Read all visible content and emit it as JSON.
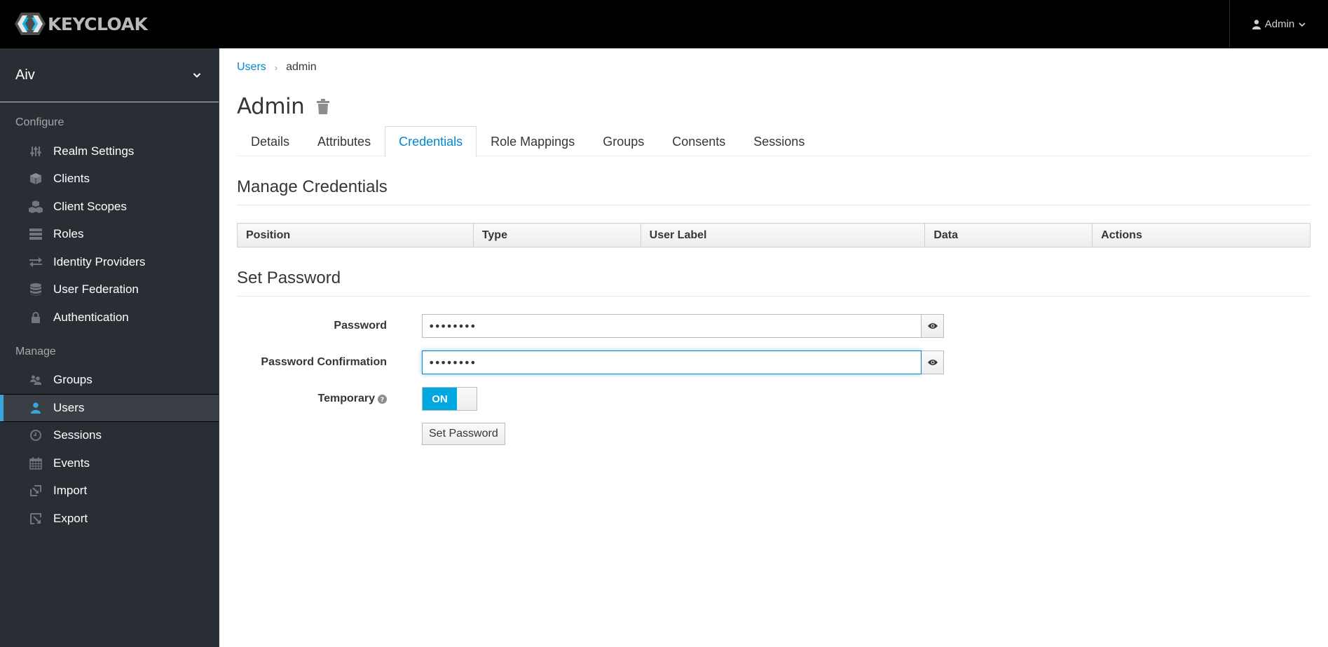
{
  "header": {
    "logo_text": "KEYCLOAK",
    "user_menu_label": "Admin",
    "user_icon": "user-icon",
    "chevron_icon": "chevron-down-icon"
  },
  "sidebar": {
    "realm": "Aiv",
    "configure_heading": "Configure",
    "configure_items": [
      {
        "label": "Realm Settings",
        "icon": "sliders-icon"
      },
      {
        "label": "Clients",
        "icon": "cube-icon"
      },
      {
        "label": "Client Scopes",
        "icon": "cubes-icon"
      },
      {
        "label": "Roles",
        "icon": "server-icon"
      },
      {
        "label": "Identity Providers",
        "icon": "exchange-icon"
      },
      {
        "label": "User Federation",
        "icon": "database-icon"
      },
      {
        "label": "Authentication",
        "icon": "lock-icon"
      }
    ],
    "manage_heading": "Manage",
    "manage_items": [
      {
        "label": "Groups",
        "icon": "users-icon"
      },
      {
        "label": "Users",
        "icon": "user-icon",
        "active": true
      },
      {
        "label": "Sessions",
        "icon": "clock-icon"
      },
      {
        "label": "Events",
        "icon": "calendar-icon"
      },
      {
        "label": "Import",
        "icon": "import-icon"
      },
      {
        "label": "Export",
        "icon": "export-icon"
      }
    ]
  },
  "breadcrumb": {
    "parent": "Users",
    "separator": "›",
    "current": "admin"
  },
  "page": {
    "title": "Admin",
    "delete_icon": "trash-icon"
  },
  "tabs": [
    {
      "label": "Details"
    },
    {
      "label": "Attributes"
    },
    {
      "label": "Credentials",
      "active": true
    },
    {
      "label": "Role Mappings"
    },
    {
      "label": "Groups"
    },
    {
      "label": "Consents"
    },
    {
      "label": "Sessions"
    }
  ],
  "manage_credentials": {
    "heading": "Manage Credentials",
    "columns": [
      "Position",
      "Type",
      "User Label",
      "Data",
      "Actions"
    ],
    "rows": []
  },
  "set_password": {
    "heading": "Set Password",
    "password_label": "Password",
    "password_value": "••••••••",
    "confirmation_label": "Password Confirmation",
    "confirmation_value": "••••••••",
    "temporary_label": "Temporary",
    "temporary_state": "ON",
    "submit_label": "Set Password"
  },
  "colors": {
    "accent": "#0088ce",
    "toggle_on": "#00a8e1",
    "active_indicator": "#39a5dc",
    "sidebar_bg": "#292e34",
    "header_bg": "#000000"
  }
}
